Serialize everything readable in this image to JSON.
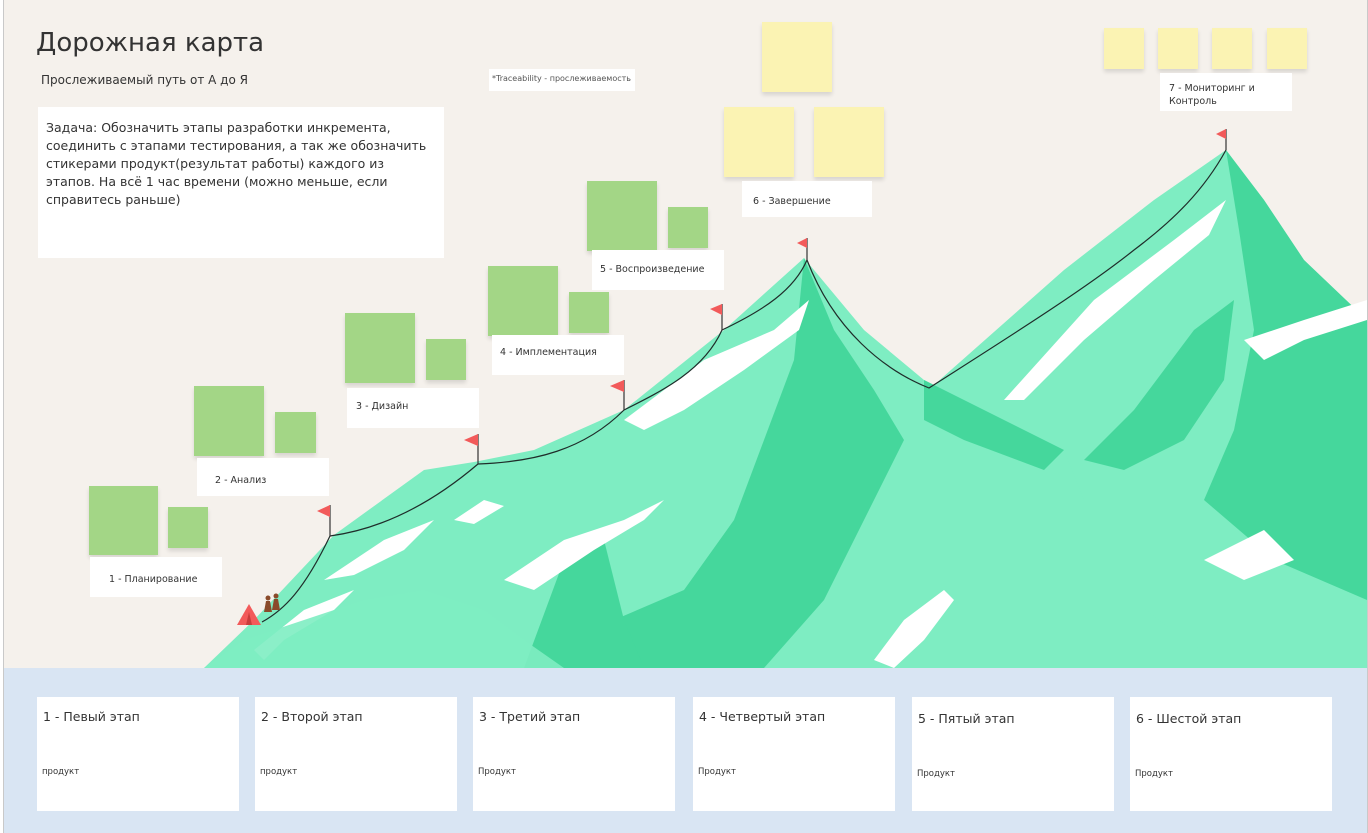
{
  "title": "Дорожная карта",
  "subtitle": "Прослеживаемый путь от А до Я",
  "note": "*Traceability - прослеживаемость",
  "task": "Задача: Обозначить этапы разработки инкремента, соединить с этапами тестирования, а так же обозначить стикерами продукт(результат работы) каждого из этапов. На всё 1 час времени (можно меньше, если справитесь раньше)",
  "stages": [
    {
      "label": "1 - Планирование"
    },
    {
      "label": "2 - Анализ"
    },
    {
      "label": "3 - Дизайн"
    },
    {
      "label": "4 - Имплементация"
    },
    {
      "label": "5 - Воспроизведение"
    },
    {
      "label": "6 - Завершение"
    },
    {
      "label": "7 - Мониторинг и Контроль"
    }
  ],
  "cards": [
    {
      "title": "1 - Певый этап",
      "product": "продукт"
    },
    {
      "title": "2 - Второй этап",
      "product": "продукт"
    },
    {
      "title": "3 - Третий этап",
      "product": "Продукт"
    },
    {
      "title": "4 - Четвертый этап",
      "product": "Продукт"
    },
    {
      "title": "5 - Пятый этап",
      "product": "Продукт"
    },
    {
      "title": "6 - Шестой этап",
      "product": "Продукт"
    }
  ],
  "colors": {
    "background": "#f5f1ec",
    "mountain_light": "#7eedc2",
    "mountain_dark": "#45d79c",
    "snow": "#ffffff",
    "flag": "#f25a5a",
    "sticky_green": "#a3d686",
    "sticky_yellow": "#fbf3b3",
    "bottom_panel": "#d9e5f3"
  },
  "icons": [
    "flag-icon",
    "tent-icon",
    "hikers-icon"
  ]
}
